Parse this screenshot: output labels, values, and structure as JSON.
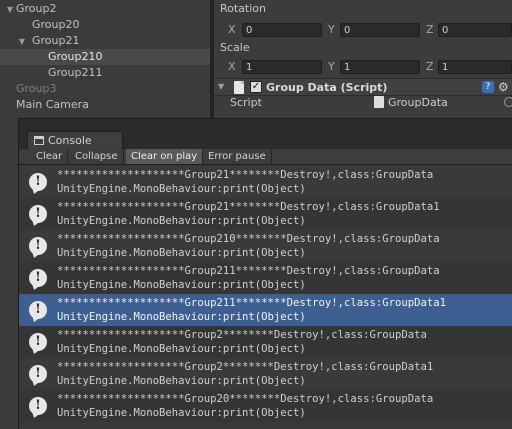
{
  "hierarchy": {
    "items": [
      {
        "label": "Group2",
        "indent": 0,
        "arrow": "▼"
      },
      {
        "label": "Group20",
        "indent": 1,
        "arrow": ""
      },
      {
        "label": "Group21",
        "indent": 1,
        "arrow": "▼"
      },
      {
        "label": "Group210",
        "indent": 2,
        "arrow": "",
        "selected": true
      },
      {
        "label": "Group211",
        "indent": 2,
        "arrow": ""
      },
      {
        "label": "Group3",
        "indent": 0,
        "arrow": "",
        "dim": true
      },
      {
        "label": "Main Camera",
        "indent": 0,
        "arrow": ""
      }
    ]
  },
  "inspector": {
    "rotation_label": "Rotation",
    "rotation": {
      "x_label": "X",
      "x": "0",
      "y_label": "Y",
      "y": "0",
      "z_label": "Z",
      "z": "0"
    },
    "scale_label": "Scale",
    "scale": {
      "x_label": "X",
      "x": "1",
      "y_label": "Y",
      "y": "1",
      "z_label": "Z",
      "z": "1"
    },
    "component": {
      "title": "Group Data (Script)",
      "enabled": "✓",
      "script_label": "Script",
      "script_value": "GroupData"
    }
  },
  "console": {
    "tab_label": "Console",
    "toolbar": {
      "clear": "Clear",
      "collapse": "Collapse",
      "clear_on_play": "Clear on play",
      "error_pause": "Error pause"
    },
    "logs": [
      {
        "line1": "********************Group21********Destroy!,class:GroupData",
        "line2": "UnityEngine.MonoBehaviour:print(Object)"
      },
      {
        "line1": "********************Group21********Destroy!,class:GroupData1",
        "line2": "UnityEngine.MonoBehaviour:print(Object)"
      },
      {
        "line1": "********************Group210********Destroy!,class:GroupData",
        "line2": "UnityEngine.MonoBehaviour:print(Object)"
      },
      {
        "line1": "********************Group211********Destroy!,class:GroupData",
        "line2": "UnityEngine.MonoBehaviour:print(Object)"
      },
      {
        "line1": "********************Group211********Destroy!,class:GroupData1",
        "line2": "UnityEngine.MonoBehaviour:print(Object)",
        "selected": true
      },
      {
        "line1": "********************Group2********Destroy!,class:GroupData",
        "line2": "UnityEngine.MonoBehaviour:print(Object)"
      },
      {
        "line1": "********************Group2********Destroy!,class:GroupData1",
        "line2": "UnityEngine.MonoBehaviour:print(Object)"
      },
      {
        "line1": "********************Group20********Destroy!,class:GroupData",
        "line2": "UnityEngine.MonoBehaviour:print(Object)"
      }
    ],
    "icon": "info-icon"
  },
  "colors": {
    "selection": "#3d5f91",
    "panel": "#3c3c3c"
  }
}
